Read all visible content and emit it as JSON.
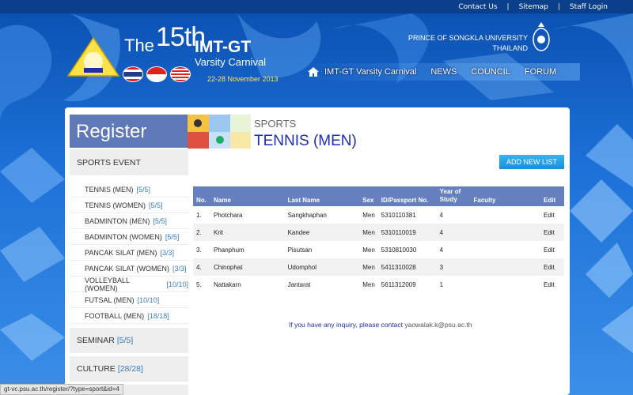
{
  "topbar": {
    "contact": "Contact Us",
    "sitemap": "Sitemap",
    "staff": "Staff Login",
    "sep": "|"
  },
  "header": {
    "title_the": "The",
    "title_num": "15th",
    "title_imt": "IMT-GT",
    "title_varsity": "Varsity Carnival",
    "title_date": "22-28 November 2013",
    "university_line1": "PRINCE OF SONGKLA UNIVERSITY",
    "university_line2": "THAILAND"
  },
  "nav": {
    "items": [
      "IMT-GT Varsity Carnival",
      "NEWS",
      "COUNCIL",
      "FORUM"
    ]
  },
  "sidebar": {
    "heading": "Register",
    "sports_event": "SPORTS EVENT",
    "items": [
      {
        "label": "TENNIS (MEN)",
        "count": "[5/5]"
      },
      {
        "label": "TENNIS (WOMEN)",
        "count": "[5/5]"
      },
      {
        "label": "BADMINTON (MEN)",
        "count": "[5/5]"
      },
      {
        "label": "BADMINTON (WOMEN)",
        "count": "[5/5]"
      },
      {
        "label": "PANCAK SILAT (MEN)",
        "count": "[3/3]"
      },
      {
        "label": "PANCAK SILAT (WOMEN)",
        "count": "[3/3]"
      },
      {
        "label": "VOLLEYBALL (WOMEN)",
        "count": "[10/10]"
      },
      {
        "label": "FUTSAL (MEN)",
        "count": "[10/10]"
      },
      {
        "label": "FOOTBALL (MEN)",
        "count": "[18/18]"
      }
    ],
    "seminar": {
      "label": "SEMINAR",
      "count": "[5/5]"
    },
    "culture": {
      "label": "CULTURE",
      "count": "[28/28]"
    }
  },
  "main": {
    "section": "SPORTS",
    "title": "TENNIS (MEN)",
    "add_button": "ADD NEW LIST",
    "columns": [
      "No.",
      "Name",
      "Last Name",
      "Sex",
      "ID/Passport No.",
      "Year of Study",
      "Faculty",
      "Edit"
    ],
    "rows": [
      {
        "no": "1.",
        "name": "Photchara",
        "last": "Sangkhaphan",
        "sex": "Men",
        "id": "5310110381",
        "year": "4",
        "faculty": "",
        "edit": "Edit"
      },
      {
        "no": "2.",
        "name": "Krit",
        "last": "Kandee",
        "sex": "Men",
        "id": "5310110019",
        "year": "4",
        "faculty": "",
        "edit": "Edit"
      },
      {
        "no": "3.",
        "name": "Phanphum",
        "last": "Pisutsan",
        "sex": "Men",
        "id": "5310810030",
        "year": "4",
        "faculty": "",
        "edit": "Edit"
      },
      {
        "no": "4.",
        "name": "Chinophat",
        "last": "Udomphol",
        "sex": "Men",
        "id": "5411310028",
        "year": "3",
        "faculty": "",
        "edit": "Edit"
      },
      {
        "no": "5.",
        "name": "Nattakarn",
        "last": "Jantarat",
        "sex": "Men",
        "id": "5611312009",
        "year": "1",
        "faculty": "",
        "edit": "Edit"
      }
    ],
    "inquiry_text": "If you have any inquiry, please contact",
    "inquiry_email": "yaowalak.k@psu.ac.th"
  },
  "statusbar": {
    "url": "gt-vc.psu.ac.th/register/?type=sport&id=4"
  },
  "colors": {
    "header_blue": "#0a4fb0",
    "table_head": "#6680bf",
    "title_blue": "#1d2eb0",
    "count_blue": "#3a7ec2",
    "button": "#1a8fd6"
  }
}
